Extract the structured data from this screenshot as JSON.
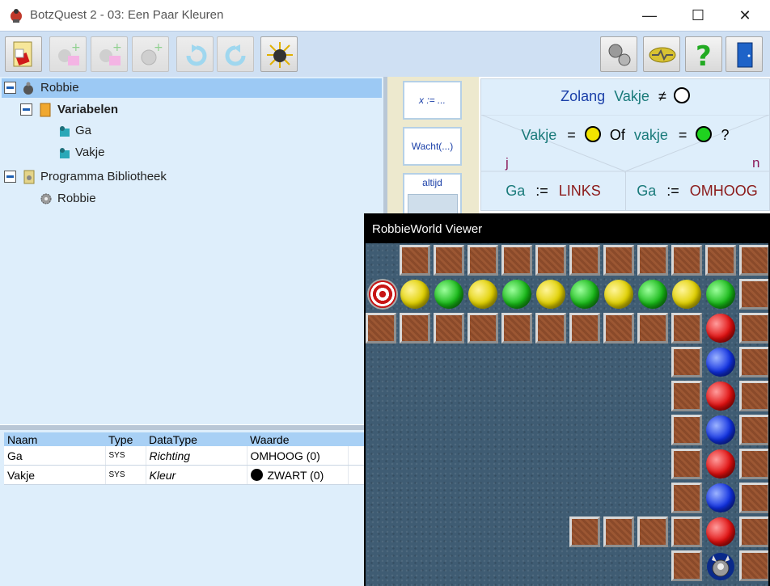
{
  "window": {
    "title": "BotzQuest 2 - 03: Een Paar Kleuren",
    "minimize": "—",
    "maximize": "☐",
    "close": "✕"
  },
  "tree": {
    "robbie": "Robbie",
    "variabelen": "Variabelen",
    "ga": "Ga",
    "vakje": "Vakje",
    "library": "Programma Bibliotheek",
    "library_robbie": "Robbie"
  },
  "variables": {
    "headers": {
      "naam": "Naam",
      "type": "Type",
      "datatype": "DataType",
      "waarde": "Waarde"
    },
    "rows": [
      {
        "naam": "Ga",
        "type": "SYS",
        "datatype": "Richting",
        "waarde": "OMHOOG (0)"
      },
      {
        "naam": "Vakje",
        "type": "SYS",
        "datatype": "Kleur",
        "waarde": "ZWART (0)",
        "swatch": "#000000"
      }
    ]
  },
  "palette": {
    "assign": "x := ...",
    "wait": "Wacht(...)",
    "always": "altijd"
  },
  "code": {
    "while_kw": "Zolang",
    "while_var": "Vakje",
    "neq": "≠",
    "cond_var1": "Vakje",
    "eq1": "=",
    "or_kw": "Of",
    "cond_var2": "vakje",
    "eq2": "=",
    "question": "?",
    "yes": "j",
    "no": "n",
    "left_var": "Ga",
    "left_assign": ":=",
    "left_val": "LINKS",
    "right_var": "Ga",
    "right_assign": ":=",
    "right_val": "OMHOOG"
  },
  "viewer": {
    "title": "RobbieWorld Viewer"
  },
  "colors": {
    "yellow": "#f2e400",
    "green": "#1fd21f",
    "red": "#e01010",
    "blue": "#1030e0"
  }
}
